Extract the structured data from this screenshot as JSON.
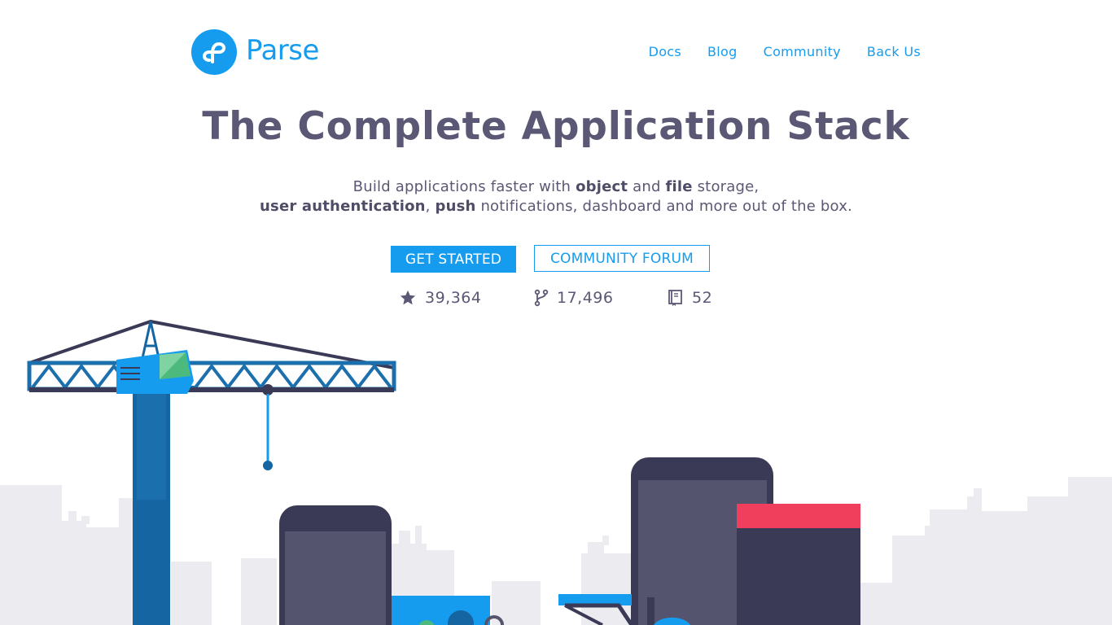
{
  "header": {
    "brand": "Parse",
    "nav": [
      {
        "label": "Docs"
      },
      {
        "label": "Blog"
      },
      {
        "label": "Community"
      },
      {
        "label": "Back Us"
      }
    ]
  },
  "hero": {
    "title": "The Complete Application Stack",
    "tagline": {
      "line1": [
        {
          "text": "Build applications faster with ",
          "bold": false
        },
        {
          "text": "object",
          "bold": true
        },
        {
          "text": " and ",
          "bold": false
        },
        {
          "text": "file",
          "bold": true
        },
        {
          "text": " storage,",
          "bold": false
        }
      ],
      "line2": [
        {
          "text": "user authentication",
          "bold": true
        },
        {
          "text": ", ",
          "bold": false
        },
        {
          "text": "push",
          "bold": true
        },
        {
          "text": " notifications, dashboard and more out of the box.",
          "bold": false
        }
      ]
    },
    "buttons": {
      "get_started": "GET STARTED",
      "community_forum": "COMMUNITY FORUM"
    },
    "stats": {
      "stars": "39,364",
      "forks": "17,496",
      "repos": "52"
    }
  },
  "icons": {
    "logo": "parse-logo-icon",
    "stars": "star-icon",
    "forks": "fork-icon",
    "repos": "repo-book-icon"
  },
  "colors": {
    "brand_blue": "#169cee",
    "heading": "#5a5874",
    "crane_blue": "#1565a3",
    "device_dark": "#3b3a56",
    "accent_red": "#ef3f5c",
    "skyline_gray": "#ebebf0"
  }
}
